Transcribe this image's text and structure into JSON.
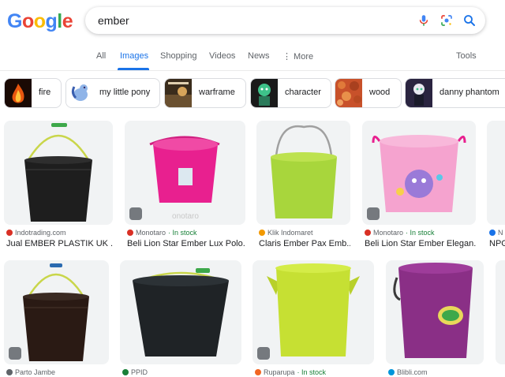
{
  "logo": {
    "letters": [
      "G",
      "o",
      "o",
      "g",
      "l",
      "e"
    ],
    "colors": [
      "#4285F4",
      "#EA4335",
      "#FBBC05",
      "#4285F4",
      "#34A853",
      "#EA4335"
    ]
  },
  "search": {
    "query": "ember"
  },
  "tabs": [
    {
      "label": "All"
    },
    {
      "label": "Images"
    },
    {
      "label": "Shopping"
    },
    {
      "label": "Videos"
    },
    {
      "label": "News"
    },
    {
      "label": "⋮ More"
    }
  ],
  "tools_label": "Tools",
  "chips": [
    {
      "label": "fire",
      "thumb_color": "#b23b0c"
    },
    {
      "label": "my little pony",
      "thumb_color": "#7fa7d9"
    },
    {
      "label": "warframe",
      "thumb_color": "#8a6a3a"
    },
    {
      "label": "character",
      "thumb_color": "#2a9a6a"
    },
    {
      "label": "wood",
      "thumb_color": "#c8512a"
    },
    {
      "label": "danny phantom",
      "thumb_color": "#4a3a6a"
    }
  ],
  "results": [
    {
      "source": "Indotrading.com",
      "in_stock": "",
      "title": "Jual EMBER PLASTIK UK ...",
      "bucket_color": "#1e1e1e",
      "fav_color": "#d93025"
    },
    {
      "source": "Monotaro",
      "in_stock": "· In stock",
      "title": "Beli Lion Star Ember Lux Polo...",
      "bucket_color": "#e8208f",
      "fav_color": "#d93025"
    },
    {
      "source": "Klik Indomaret",
      "in_stock": "",
      "title": "Claris Ember Pax Emb...",
      "bucket_color": "#a8d63c",
      "fav_color": "#f29900"
    },
    {
      "source": "Monotaro",
      "in_stock": "· In stock",
      "title": "Beli Lion Star Ember Elegan...",
      "bucket_color": "#f5a3cf",
      "fav_color": "#d93025"
    },
    {
      "source": "N",
      "in_stock": "",
      "title": "NPG",
      "bucket_color": "#ffffff",
      "fav_color": "#1a73e8"
    },
    {
      "source": "Parto Jambe",
      "in_stock": "",
      "title": "",
      "bucket_color": "#2a1a14",
      "fav_color": "#5f6368"
    },
    {
      "source": "PPID",
      "in_stock": "",
      "title": "",
      "bucket_color": "#1f2326",
      "fav_color": "#188038"
    },
    {
      "source": "Ruparupa",
      "in_stock": "· In stock",
      "title": "",
      "bucket_color": "#c6e033",
      "fav_color": "#f26522"
    },
    {
      "source": "Blibli.com",
      "in_stock": "",
      "title": "",
      "bucket_color": "#8a2f86",
      "fav_color": "#0095da"
    }
  ],
  "colors": {
    "accent": "#1a73e8",
    "in_stock": "#188038"
  }
}
